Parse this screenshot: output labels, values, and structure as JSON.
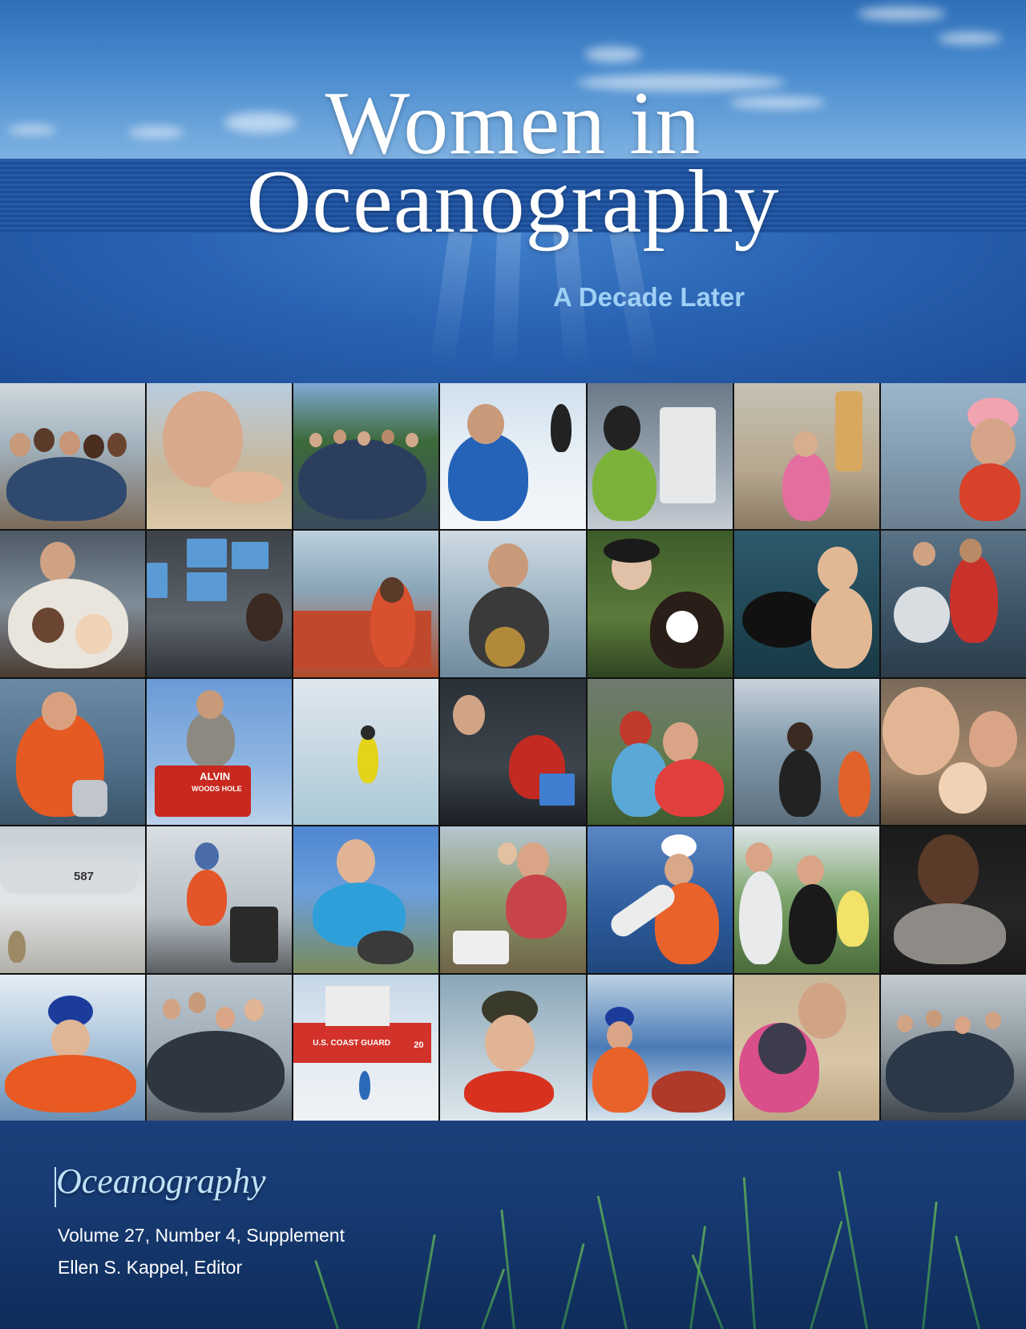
{
  "cover": {
    "title_line1": "Women in",
    "title_line2": "Oceanography",
    "subtitle": "A Decade Later"
  },
  "colors": {
    "title": "#ffffff",
    "subtitle": "#9fd0f5",
    "journal": "#bfe2f7",
    "sky": "#4a8ccf",
    "ocean": "#1e4d97",
    "bottom": "#163a72"
  },
  "photos": {
    "alvin_sign_line1": "ALVIN",
    "alvin_sign_line2": "WOODS HOLE",
    "plane_number": "587",
    "ship_hull_text": "U.S. COAST GUARD",
    "ship_number": "20"
  },
  "footer": {
    "journal": "Oceanography",
    "volume": "Volume 27, Number 4, Supplement",
    "editor": "Ellen S. Kappel, Editor"
  }
}
